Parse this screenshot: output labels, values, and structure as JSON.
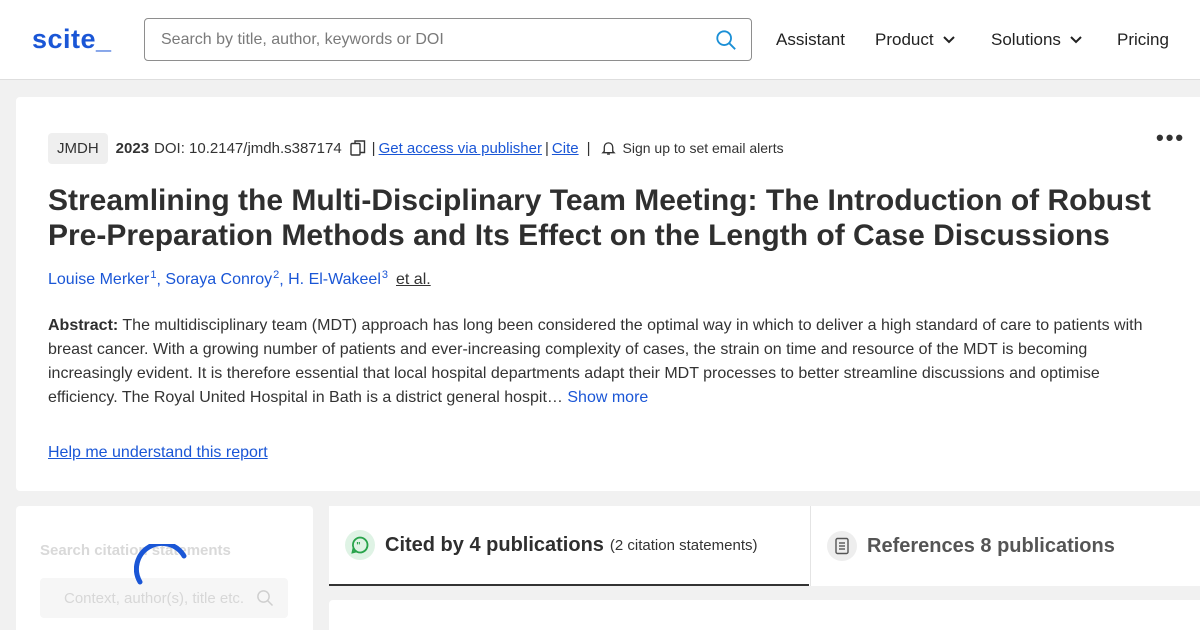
{
  "header": {
    "logo": "scite_",
    "search_placeholder": "Search by title, author, keywords or DOI",
    "nav": [
      {
        "label": "Assistant"
      },
      {
        "label": "Product"
      },
      {
        "label": "Solutions"
      },
      {
        "label": "Pricing"
      }
    ]
  },
  "paper": {
    "journal": "JMDH",
    "year": "2023",
    "doi": "DOI: 10.2147/jmdh.s387174",
    "access_link": "Get access via publisher",
    "cite_link": "Cite",
    "alerts_label": "Sign up to set email alerts",
    "more_label": "•••",
    "title": "Streamlining the Multi-Disciplinary Team Meeting: The Introduction of Robust Pre-Preparation Methods and Its Effect on the Length of Case Discussions",
    "authors": [
      {
        "name": "Louise Merker",
        "sup": "1"
      },
      {
        "name": "Soraya Conroy",
        "sup": "2"
      },
      {
        "name": "H. El-Wakeel",
        "sup": "3"
      }
    ],
    "etal": "et al.",
    "abstract_label": "Abstract:",
    "abstract_text": "The multidisciplinary team (MDT) approach has long been considered the optimal way in which to deliver a high standard of care to patients with breast cancer. With a growing number of patients and ever-increasing complexity of cases, the strain on time and resource of the MDT is becoming increasingly evident. It is therefore essential that local hospital departments adapt their MDT processes to better streamline discussions and optimise efficiency. The Royal United Hospital in Bath is a district general hospit…",
    "show_more": "Show more",
    "help_link": "Help me understand this report"
  },
  "citations_panel": {
    "label": "Search citation statements",
    "placeholder": "Context, author(s), title etc."
  },
  "tabs": [
    {
      "title": "Cited by 4 publications",
      "sub": "(2 citation statements)"
    },
    {
      "title": "References 8 publications",
      "sub": ""
    }
  ],
  "colors": {
    "accent": "#1a56d6",
    "cited_icon": "#27a34a"
  },
  "icons": [
    "search-icon",
    "chevron-down-icon",
    "copy-icon",
    "bell-icon",
    "quote-icon",
    "document-icon",
    "loading-spinner"
  ]
}
